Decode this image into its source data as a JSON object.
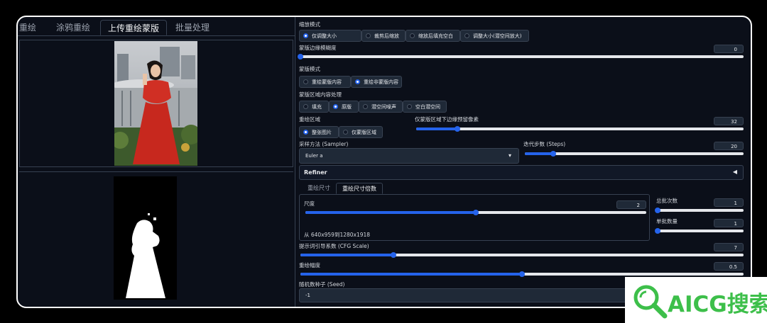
{
  "tabs": [
    "重绘",
    "涂鸦重绘",
    "上传重绘蒙版",
    "批量处理"
  ],
  "resize_mode": {
    "label": "缩放模式",
    "options": [
      "仅调整大小",
      "裁剪后缩放",
      "缩放后填充空白",
      "调整大小(潜空间放大)"
    ],
    "selected": 0
  },
  "mask_blur": {
    "label": "蒙版边缘模糊度",
    "value": "0",
    "fraction": 0
  },
  "mask_mode": {
    "label": "蒙版模式",
    "options": [
      "重绘蒙版内容",
      "重绘非蒙版内容"
    ],
    "selected": 1
  },
  "masked_content": {
    "label": "蒙版区域内容处理",
    "options": [
      "填充",
      "原版",
      "潜空间噪声",
      "空白潜空间"
    ],
    "selected": 1
  },
  "inpaint_area": {
    "label": "重绘区域",
    "options": [
      "整张图片",
      "仅蒙版区域"
    ],
    "selected": 0
  },
  "only_masked_padding": {
    "label": "仅蒙版区域下边缘预留像素",
    "value": "32",
    "fraction": 0.125
  },
  "sampler": {
    "label": "采样方法 (Sampler)",
    "value": "Euler a",
    "arrow": "▾"
  },
  "steps": {
    "label": "迭代步数 (Steps)",
    "value": "20",
    "fraction": 0.13
  },
  "refiner": {
    "label": "Refiner",
    "arrow": "◀"
  },
  "size_tabs": [
    "重绘尺寸",
    "重绘尺寸倍数"
  ],
  "scale": {
    "label": "尺度",
    "value": "2",
    "fraction": 0.5,
    "note": "从 640x959到1280x1918"
  },
  "batch_count": {
    "label": "总批次数",
    "value": "1",
    "fraction": 0
  },
  "batch_size": {
    "label": "单批数量",
    "value": "1",
    "fraction": 0
  },
  "cfg": {
    "label": "提示词引导系数 (CFG Scale)",
    "value": "7",
    "fraction": 0.21
  },
  "denoise": {
    "label": "重绘幅度",
    "value": "0.5",
    "fraction": 0.5
  },
  "seed": {
    "label": "随机数种子 (Seed)",
    "value": "-1"
  },
  "logo": {
    "text": "AICG搜索"
  },
  "colors": {
    "accent": "#2563eb",
    "bg": "#0b0f19",
    "logo_green": "#3dbf4a"
  }
}
